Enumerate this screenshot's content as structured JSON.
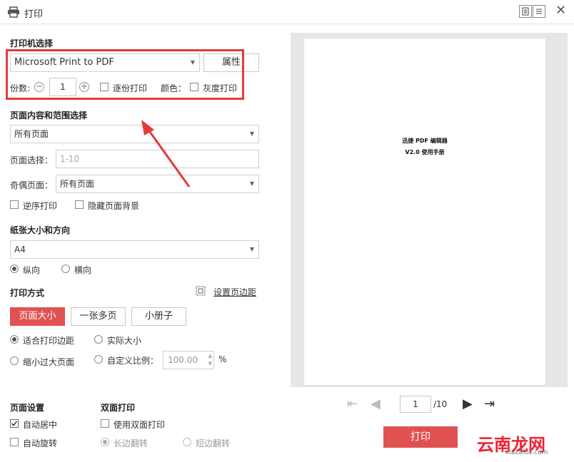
{
  "window": {
    "title": "打印",
    "icons": {
      "printer": "printer-icon",
      "close": "close-icon",
      "view_single": "single-page-view-icon",
      "view_list": "list-view-icon"
    }
  },
  "printer": {
    "section_title": "打印机选择",
    "selected": "Microsoft Print to PDF",
    "properties_label": "属性",
    "copies_label": "份数:",
    "copies_value": "1",
    "collate_label": "逐份打印",
    "color_label": "颜色：",
    "grayscale_label": "灰度打印"
  },
  "range": {
    "section_title": "页面内容和范围选择",
    "content_selected": "所有页面",
    "pages_label": "页面选择：",
    "pages_placeholder": "1-10",
    "oddeven_label": "奇偶页面：",
    "oddeven_selected": "所有页面",
    "reverse_label": "逆序打印",
    "hide_bg_label": "隐藏页面背景"
  },
  "paper": {
    "section_title": "纸张大小和方向",
    "size_selected": "A4",
    "portrait_label": "纵向",
    "landscape_label": "横向"
  },
  "mode": {
    "section_title": "打印方式",
    "margin_link": "设置页边距",
    "tabs": [
      "页面大小",
      "一张多页",
      "小册子"
    ],
    "fit_label": "适合打印边距",
    "actual_label": "实际大小",
    "shrink_label": "缩小过大页面",
    "custom_label": "自定义比例：",
    "custom_value": "100.00",
    "percent": "%"
  },
  "page_setup": {
    "section_title": "页面设置",
    "auto_center": "自动居中",
    "auto_rotate": "自动旋转"
  },
  "duplex": {
    "section_title": "双面打印",
    "use_duplex": "使用双面打印",
    "long_edge": "长边翻转",
    "short_edge": "短边翻转"
  },
  "preview": {
    "line1": "迅捷 PDF 编辑器",
    "line2": "V2.0 使用手册",
    "page_value": "1",
    "page_total": "/10"
  },
  "actions": {
    "print_label": "打印"
  },
  "watermark": {
    "text": "云南龙网",
    "sub": "xiazaiba.com"
  },
  "colors": {
    "accent": "#e05252",
    "highlight": "#e33a3a"
  }
}
